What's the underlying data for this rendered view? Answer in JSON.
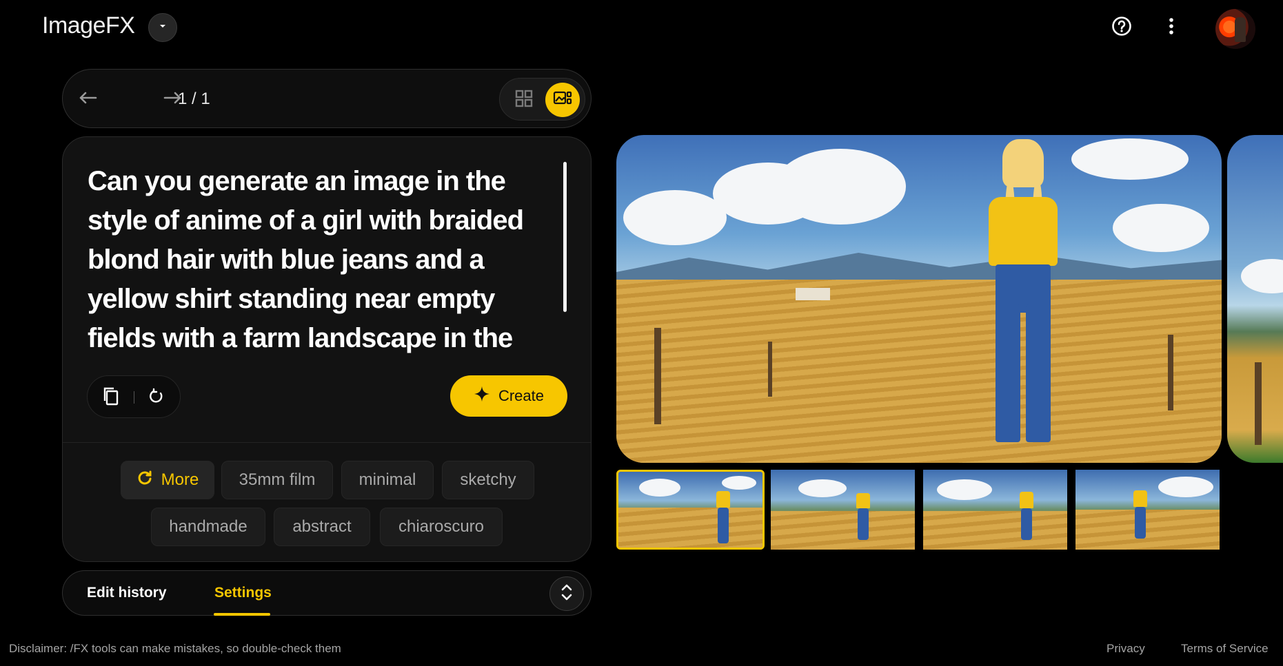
{
  "app": {
    "title": "ImageFX"
  },
  "nav": {
    "counter": "1 / 1"
  },
  "prompt": {
    "text": "Can you generate an image in the style of anime of a girl with braided blond hair with blue jeans and a yellow shirt standing near empty fields with a farm landscape in the"
  },
  "actions": {
    "create_label": "Create"
  },
  "chips": {
    "more": "More",
    "items": [
      "35mm film",
      "minimal",
      "sketchy",
      "handmade",
      "abstract",
      "chiaroscuro"
    ]
  },
  "tabs": {
    "edit_history": "Edit history",
    "settings": "Settings"
  },
  "footer": {
    "disclaimer": "Disclaimer: /FX tools can make mistakes, so double-check them",
    "privacy": "Privacy",
    "terms": "Terms of Service"
  },
  "icons": {
    "brand_dropdown": "chevron-down-icon",
    "help": "help-circle-icon",
    "menu": "more-vertical-icon",
    "prev": "arrow-left-icon",
    "next": "arrow-right-icon",
    "grid_view": "grid-icon",
    "single_view": "image-view-icon",
    "copy": "copy-icon",
    "redo": "refresh-icon",
    "create": "sparkle-icon",
    "more": "refresh-icon",
    "expand": "unfold-icon"
  },
  "colors": {
    "accent": "#f7c600",
    "background": "#000000",
    "card": "#121212"
  }
}
